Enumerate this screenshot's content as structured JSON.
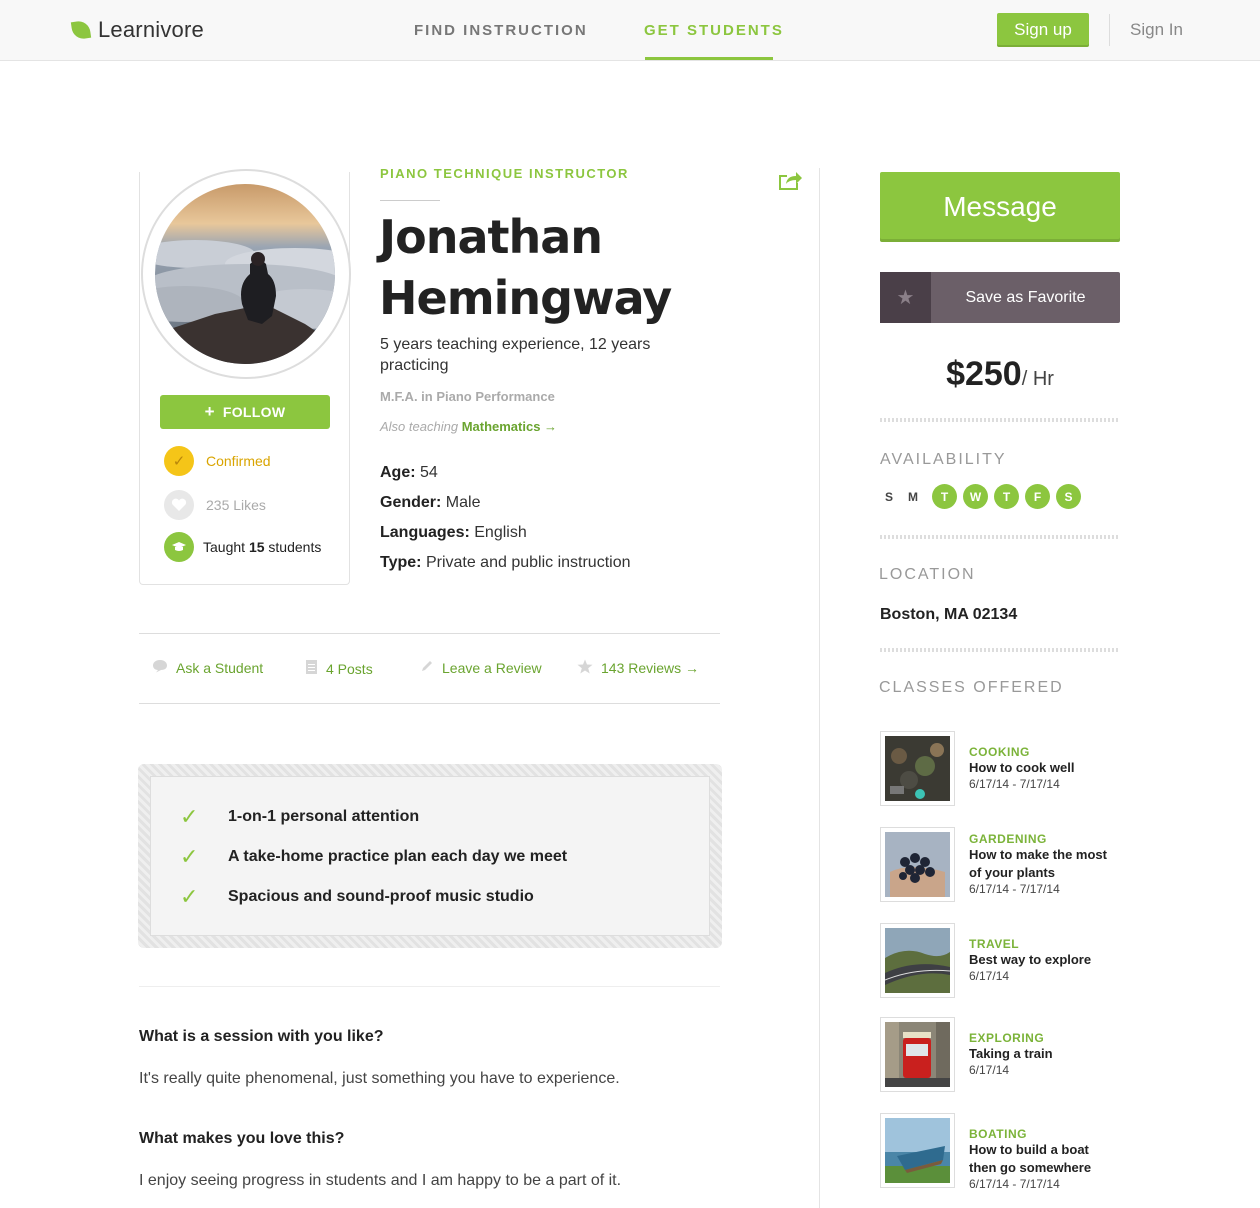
{
  "header": {
    "brand": "Learnivore",
    "nav": [
      "FIND INSTRUCTION",
      "GET STUDENTS"
    ],
    "active_nav": "GET STUDENTS",
    "signup": "Sign up",
    "signin": "Sign In"
  },
  "profile": {
    "follow": "FOLLOW",
    "confirmed": "Confirmed",
    "likes": "235 Likes",
    "taught_prefix": "Taught ",
    "taught_count": "15",
    "taught_suffix": " students"
  },
  "instructor": {
    "role": "PIANO TECHNIQUE INSTRUCTOR",
    "first_name": "Jonathan",
    "last_name": "Hemingway",
    "experience": "5 years teaching experience, 12 years practicing",
    "degree": "M.F.A. in Piano Performance",
    "also_prefix": "Also teaching",
    "also_subject": "Mathematics →",
    "details": [
      {
        "label": "Age:",
        "value": "54"
      },
      {
        "label": "Gender:",
        "value": "Male"
      },
      {
        "label": "Languages:",
        "value": "English"
      },
      {
        "label": "Type:",
        "value": "Private and public instruction"
      }
    ]
  },
  "actions": {
    "ask": "Ask a Student",
    "posts": "4 Posts",
    "review": "Leave a Review",
    "reviews": "143 Reviews →"
  },
  "features": [
    "1-on-1 personal attention",
    "A take-home practice plan each day we meet",
    "Spacious and sound-proof music studio"
  ],
  "qa": [
    {
      "q": "What is a session with you like?",
      "a": "It's really quite phenomenal, just something you have to experience."
    },
    {
      "q": "What makes you love this?",
      "a": "I enjoy seeing progress in students and I am happy to be a part of it."
    }
  ],
  "sidebar": {
    "message": "Message",
    "favorite": "Save as Favorite",
    "price": "$250",
    "price_unit": "/ Hr",
    "availability_heading": "AVAILABILITY",
    "days": [
      {
        "d": "S",
        "on": false
      },
      {
        "d": "M",
        "on": false
      },
      {
        "d": "T",
        "on": true
      },
      {
        "d": "W",
        "on": true
      },
      {
        "d": "T",
        "on": true
      },
      {
        "d": "F",
        "on": true
      },
      {
        "d": "S",
        "on": true
      }
    ],
    "location_heading": "LOCATION",
    "location": "Boston, MA 02134",
    "classes_heading": "CLASSES OFFERED",
    "classes": [
      {
        "cat": "COOKING",
        "title": "How to cook well",
        "date": "6/17/14 - 7/17/14"
      },
      {
        "cat": "GARDENING",
        "title": "How to make the most of your plants",
        "date": "6/17/14 - 7/17/14"
      },
      {
        "cat": "TRAVEL",
        "title": "Best way to explore",
        "date": "6/17/14"
      },
      {
        "cat": "EXPLORING",
        "title": "Taking a train",
        "date": "6/17/14"
      },
      {
        "cat": "BOATING",
        "title": "How to build a boat then go somewhere",
        "date": "6/17/14 - 7/17/14"
      }
    ]
  },
  "colors": {
    "accent": "#8cc63f",
    "favorite": "#6b5f68",
    "confirmed": "#f5c518"
  }
}
